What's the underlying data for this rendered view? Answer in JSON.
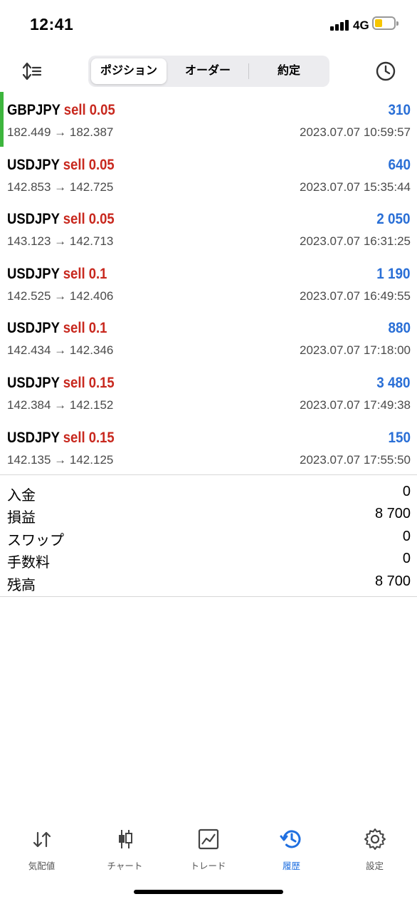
{
  "status": {
    "time": "12:41",
    "network": "4G"
  },
  "tabs": [
    {
      "label": "ポジション",
      "active": true
    },
    {
      "label": "オーダー",
      "active": false
    },
    {
      "label": "約定",
      "active": false
    }
  ],
  "icons": {
    "sort": "sort-icon",
    "history": "clock-icon"
  },
  "trades": [
    {
      "symbol": "GBPJPY",
      "side": "sell 0.05",
      "profit": "310",
      "prices": "182.449 → 182.387",
      "date": "2023.07.07 10:59:57"
    },
    {
      "symbol": "USDJPY",
      "side": "sell 0.05",
      "profit": "640",
      "prices": "142.853 → 142.725",
      "date": "2023.07.07 15:35:44"
    },
    {
      "symbol": "USDJPY",
      "side": "sell 0.05",
      "profit": "2 050",
      "prices": "143.123 → 142.713",
      "date": "2023.07.07 16:31:25"
    },
    {
      "symbol": "USDJPY",
      "side": "sell 0.1",
      "profit": "1 190",
      "prices": "142.525 → 142.406",
      "date": "2023.07.07 16:49:55"
    },
    {
      "symbol": "USDJPY",
      "side": "sell 0.1",
      "profit": "880",
      "prices": "142.434 → 142.346",
      "date": "2023.07.07 17:18:00"
    },
    {
      "symbol": "USDJPY",
      "side": "sell 0.15",
      "profit": "3 480",
      "prices": "142.384 → 142.152",
      "date": "2023.07.07 17:49:38"
    },
    {
      "symbol": "USDJPY",
      "side": "sell 0.15",
      "profit": "150",
      "prices": "142.135 → 142.125",
      "date": "2023.07.07 17:55:50"
    }
  ],
  "summary": [
    {
      "label": "入金",
      "value": "0"
    },
    {
      "label": "損益",
      "value": "8 700"
    },
    {
      "label": "スワップ",
      "value": "0"
    },
    {
      "label": "手数料",
      "value": "0"
    },
    {
      "label": "残高",
      "value": "8 700"
    }
  ],
  "bottom_nav": [
    {
      "label": "気配値",
      "icon": "quotes-icon",
      "active": false
    },
    {
      "label": "チャート",
      "icon": "candlestick-icon",
      "active": false
    },
    {
      "label": "トレード",
      "icon": "trade-chart-icon",
      "active": false
    },
    {
      "label": "履歴",
      "icon": "history-icon",
      "active": true
    },
    {
      "label": "設定",
      "icon": "settings-gear-icon",
      "active": false
    }
  ],
  "colors": {
    "sell": "#c8281e",
    "profit": "#2a6fd6",
    "active_tab": "#1f6fe0",
    "indicator": "#3db53d"
  }
}
